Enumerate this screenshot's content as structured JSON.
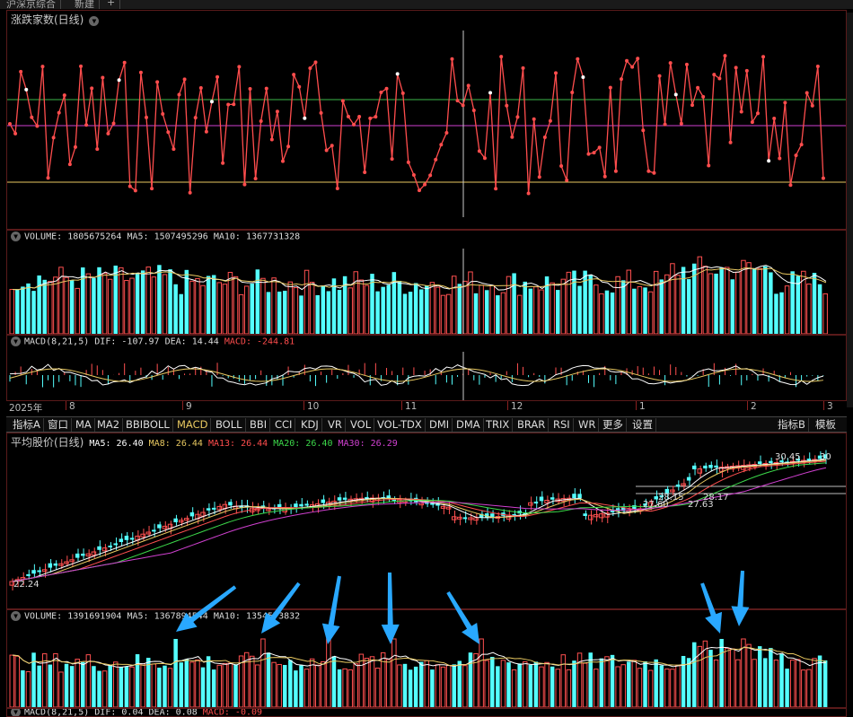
{
  "tabs": [
    "沪深京综合",
    "新建",
    "+"
  ],
  "panel1": {
    "title": "涨跌家数(日线)"
  },
  "vol1": {
    "label": "VOLUME:",
    "value": "1805675264",
    "ma5_label": "MA5:",
    "ma5": "1507495296",
    "ma10_label": "MA10:",
    "ma10": "1367731328"
  },
  "macd1": {
    "label": "MACD(8,21,5)",
    "dif_label": "DIF:",
    "dif": "-107.97",
    "dea_label": "DEA:",
    "dea": "14.44",
    "macd_label": "MACD:",
    "macd": "-244.81"
  },
  "axis": {
    "year": "2025年",
    "months": [
      "8",
      "9",
      "10",
      "11",
      "12",
      "1",
      "2",
      "3"
    ]
  },
  "indicators": [
    "指标A",
    "窗口",
    "MA",
    "MA2",
    "BBIBOLL",
    "MACD",
    "BOLL",
    "BBI",
    "CCI",
    "KDJ",
    "VR",
    "VOL",
    "VOL-TDX",
    "DMI",
    "DMA",
    "TRIX",
    "BRAR",
    "RSI",
    "WR",
    "更多",
    "设置"
  ],
  "indicators_right": [
    "指标B",
    "模板"
  ],
  "panel2": {
    "title": "平均股价(日线)",
    "ma5_label": "MA5:",
    "ma5": "26.40",
    "ma8_label": "MA8:",
    "ma8": "26.44",
    "ma13_label": "MA13:",
    "ma13": "26.44",
    "ma20_label": "MA20:",
    "ma20": "26.40",
    "ma30_label": "MA30:",
    "ma30": "26.29",
    "price_labels": [
      "30.45",
      "30",
      "28.15",
      "28.17",
      "27.60",
      "27.63",
      "22.24"
    ]
  },
  "vol2": {
    "label": "VOLUME:",
    "value": "1391691904",
    "ma5_label": "MA5:",
    "ma5": "1367894544",
    "ma10_label": "MA10:",
    "ma10": "1354573832"
  },
  "macd2": {
    "label": "MACD(8,21,5)",
    "dif_label": "DIF:",
    "dif": "0.04",
    "dea_label": "DEA:",
    "dea": "0.08",
    "macd_label": "MACD:",
    "macd": "-0.09"
  },
  "colors": {
    "up": "#ff5050",
    "down": "#54ffff",
    "line_red": "#ff4d4d",
    "green_line": "#3cb84a",
    "magenta_line": "#d040d0",
    "yellow_line": "#e8c860",
    "arrow": "#29a8ff"
  }
}
